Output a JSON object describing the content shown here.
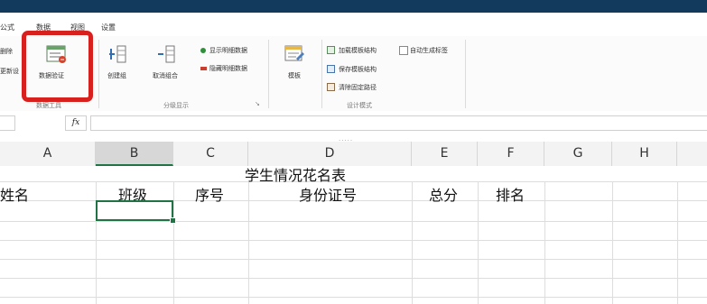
{
  "tabs": [
    "公式",
    "数据",
    "视图",
    "设置"
  ],
  "ribbon": {
    "left_partial": [
      "删除",
      "更新设"
    ],
    "data_validation": "数据验证",
    "data_tools_group": "数据工具",
    "create_group": "创建组",
    "ungroup": "取消组合",
    "show_detail": "显示明细数据",
    "hide_detail": "隐藏明细数据",
    "outline_group": "分级显示",
    "template": "模板",
    "add_template_structure": "加载模板结构",
    "save_template_structure": "保存模板结构",
    "clear_fixed_path": "清除固定路径",
    "auto_generate_label": "自动生成标签",
    "design_group": "设计模式"
  },
  "formula_bar": {
    "fx": "fx",
    "grip": "....."
  },
  "columns": [
    "A",
    "B",
    "C",
    "D",
    "E",
    "F",
    "G",
    "H"
  ],
  "selected_column": "B",
  "sheet": {
    "title": "学生情况花名表",
    "headers": [
      "姓名",
      "班级",
      "序号",
      "身份证号",
      "总分",
      "排名"
    ]
  }
}
